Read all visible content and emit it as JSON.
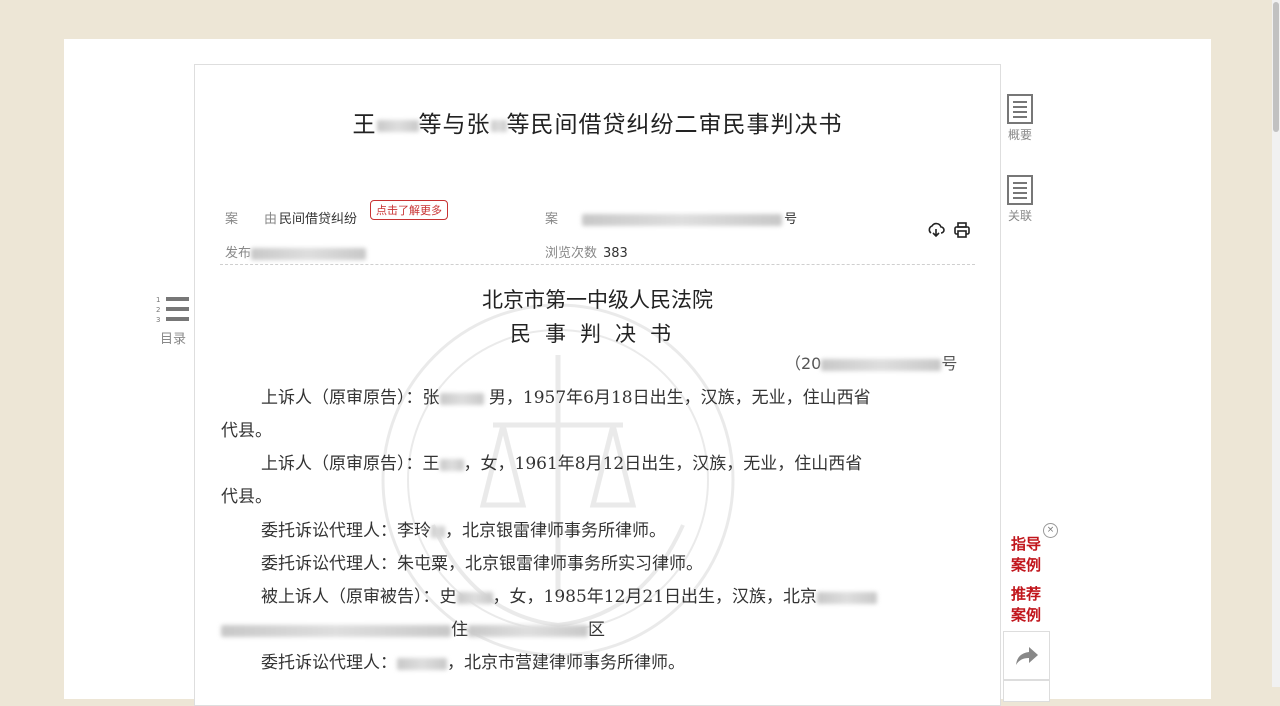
{
  "document": {
    "title_part1": "王",
    "title_part2": "等与张",
    "title_part3": "等民间借贷纠纷二审民事判决书"
  },
  "meta": {
    "cause_label": "案　　由",
    "cause_value": "民间借贷纠纷",
    "learn_more": "点击了解更多",
    "caseno_label": "案",
    "caseno_suffix": "号",
    "publish_label": "发布",
    "views_label": "浏览次数",
    "views_value": "383"
  },
  "toolbar": {
    "download_icon": "download-icon",
    "print_icon": "print-icon"
  },
  "body": {
    "court": "北京市第一中级人民法院",
    "doc_type": "民事判决书",
    "caseno_prefix": "（20",
    "caseno_end": "号",
    "paragraphs": [
      {
        "p1": "上诉人（原审原告）：张",
        "p2": "男，1957年6月18日出生，汉族，无业，住山西省",
        "p3": "代县。"
      },
      {
        "p1": "上诉人（原审原告）：王",
        "p2": "，女，1961年8月12日出生，汉族，无业，住山西省",
        "p3": "代县。"
      },
      {
        "p1": "委托诉讼代理人：李玲",
        "p2": "，北京银雷律师事务所律师。"
      },
      {
        "p1": "委托诉讼代理人：朱屯粟，北京银雷律师事务所实习律师。"
      },
      {
        "p1": "被上诉人（原审被告）：史",
        "p2": "，女，1985年12月21日出生，汉族，北京",
        "p3": "住",
        "p4": "区"
      },
      {
        "p1": "委托诉讼代理人：",
        "p2": "，北京市营建律师事务所律师。"
      }
    ]
  },
  "sidebar": {
    "summary": "概要",
    "related": "关联",
    "toc": "目录",
    "toc_numbers": [
      "1",
      "2",
      "3"
    ]
  },
  "promo": {
    "guide_line1": "指导",
    "guide_line2": "案例",
    "recommend_line1": "推荐",
    "recommend_line2": "案例",
    "close": "×",
    "share_icon": "share-icon"
  }
}
